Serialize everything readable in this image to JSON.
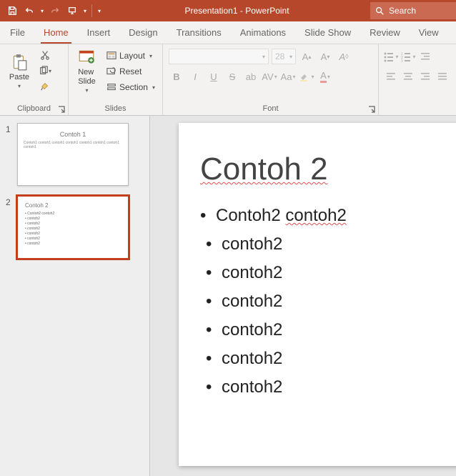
{
  "titlebar": {
    "doc_name": "Presentation1",
    "app_name": "PowerPoint",
    "search_placeholder": "Search"
  },
  "tabs": {
    "file": "File",
    "home": "Home",
    "insert": "Insert",
    "design": "Design",
    "transitions": "Transitions",
    "animations": "Animations",
    "slideshow": "Slide Show",
    "review": "Review",
    "view": "View"
  },
  "ribbon": {
    "clipboard": {
      "label": "Clipboard",
      "paste": "Paste"
    },
    "slides": {
      "label": "Slides",
      "new_slide": "New\nSlide",
      "layout": "Layout",
      "reset": "Reset",
      "section": "Section"
    },
    "font": {
      "label": "Font",
      "font_name": "",
      "font_size": "28"
    },
    "paragraph": {
      "label": ""
    }
  },
  "thumbnails": [
    {
      "num": "1",
      "title": "Contoh 1",
      "subtitle": "Contoh1 contoh1 contoh1 contoh1 contoh1 contoh1 contoh1 contoh1",
      "selected": false,
      "layout": "title"
    },
    {
      "num": "2",
      "title": "Contoh 2",
      "bullets": [
        "Contoh2 contoh2",
        "contoh2",
        "contoh2",
        "contoh2",
        "contoh2",
        "contoh2",
        "contoh2"
      ],
      "selected": true,
      "layout": "bullets"
    }
  ],
  "slide": {
    "title": "Contoh 2",
    "bullets": [
      {
        "text": "Contoh2 ",
        "tail": "contoh2",
        "tail_squiggle": true,
        "indent": 0
      },
      {
        "text": "contoh2",
        "indent": 1
      },
      {
        "text": "contoh2",
        "indent": 1
      },
      {
        "text": "contoh2",
        "indent": 1
      },
      {
        "text": "contoh2",
        "indent": 1
      },
      {
        "text": "contoh2",
        "indent": 1
      },
      {
        "text": "contoh2",
        "indent": 1
      }
    ]
  }
}
